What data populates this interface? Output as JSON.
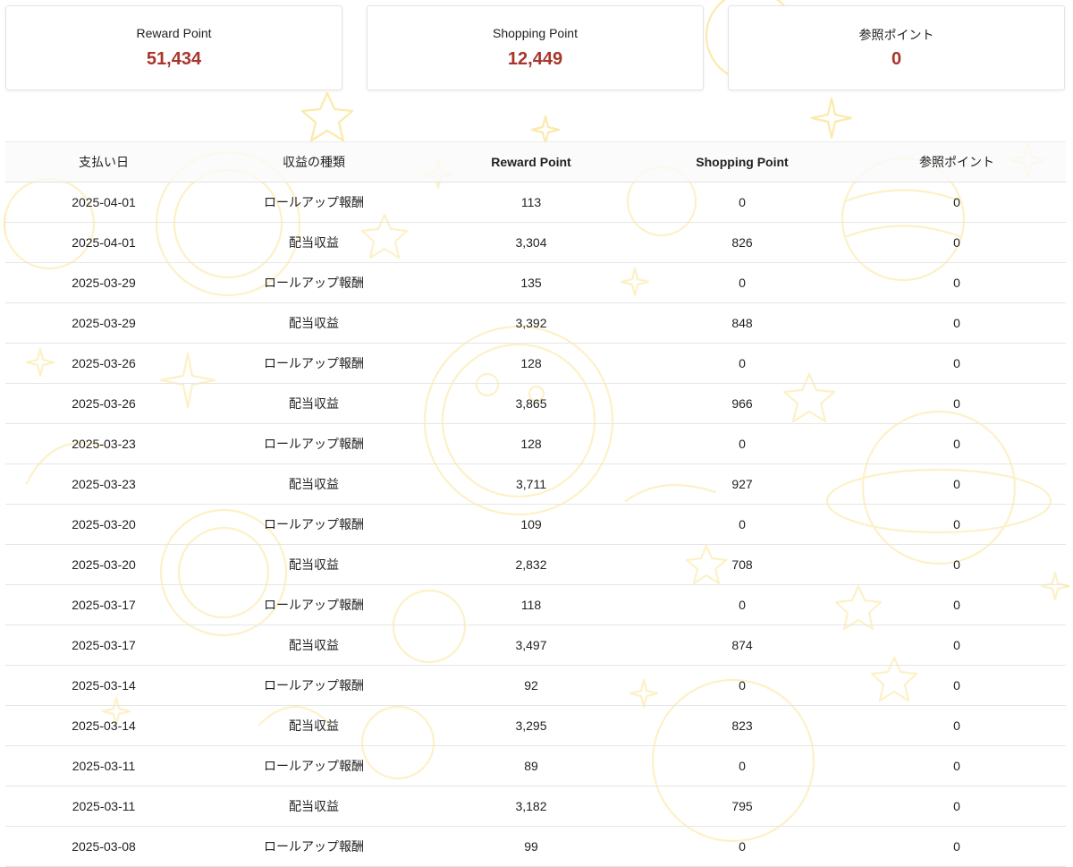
{
  "summary": [
    {
      "label": "Reward Point",
      "value": "51,434"
    },
    {
      "label": "Shopping Point",
      "value": "12,449"
    },
    {
      "label": "参照ポイント",
      "value": "0"
    }
  ],
  "table": {
    "headers": [
      "支払い日",
      "収益の種類",
      "Reward Point",
      "Shopping Point",
      "参照ポイント"
    ],
    "rows": [
      [
        "2025-04-01",
        "ロールアップ報酬",
        "113",
        "0",
        "0"
      ],
      [
        "2025-04-01",
        "配当収益",
        "3,304",
        "826",
        "0"
      ],
      [
        "2025-03-29",
        "ロールアップ報酬",
        "135",
        "0",
        "0"
      ],
      [
        "2025-03-29",
        "配当収益",
        "3,392",
        "848",
        "0"
      ],
      [
        "2025-03-26",
        "ロールアップ報酬",
        "128",
        "0",
        "0"
      ],
      [
        "2025-03-26",
        "配当収益",
        "3,865",
        "966",
        "0"
      ],
      [
        "2025-03-23",
        "ロールアップ報酬",
        "128",
        "0",
        "0"
      ],
      [
        "2025-03-23",
        "配当収益",
        "3,711",
        "927",
        "0"
      ],
      [
        "2025-03-20",
        "ロールアップ報酬",
        "109",
        "0",
        "0"
      ],
      [
        "2025-03-20",
        "配当収益",
        "2,832",
        "708",
        "0"
      ],
      [
        "2025-03-17",
        "ロールアップ報酬",
        "118",
        "0",
        "0"
      ],
      [
        "2025-03-17",
        "配当収益",
        "3,497",
        "874",
        "0"
      ],
      [
        "2025-03-14",
        "ロールアップ報酬",
        "92",
        "0",
        "0"
      ],
      [
        "2025-03-14",
        "配当収益",
        "3,295",
        "823",
        "0"
      ],
      [
        "2025-03-11",
        "ロールアップ報酬",
        "89",
        "0",
        "0"
      ],
      [
        "2025-03-11",
        "配当収益",
        "3,182",
        "795",
        "0"
      ],
      [
        "2025-03-08",
        "ロールアップ報酬",
        "99",
        "0",
        "0"
      ]
    ]
  },
  "colors": {
    "accent_value": "#a8342a",
    "doodle": "#fbe9a6"
  }
}
